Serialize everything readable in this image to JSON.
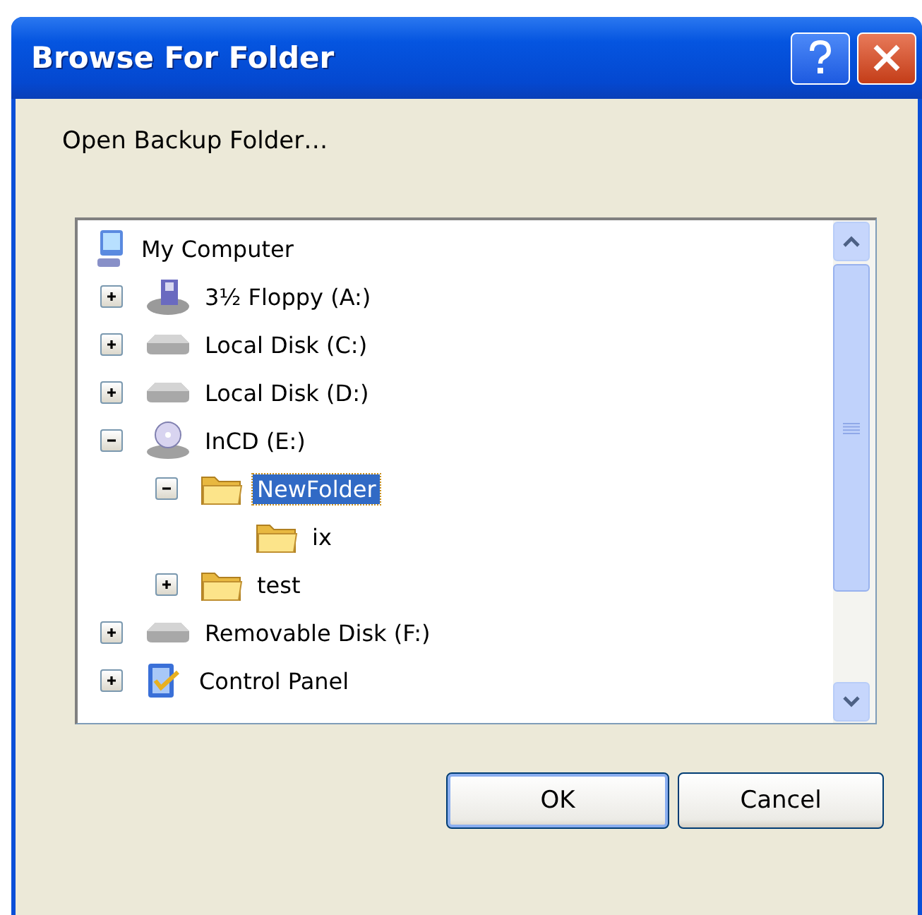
{
  "window": {
    "title": "Browse For Folder"
  },
  "description": "Open Backup Folder…",
  "tree": [
    {
      "label": "My Computer",
      "kind": "computer",
      "selected": false,
      "children": [
        {
          "label": "3½ Floppy (A:)",
          "kind": "floppy",
          "selected": false,
          "expanded": false
        },
        {
          "label": "Local Disk (C:)",
          "kind": "disk",
          "selected": false,
          "expanded": false
        },
        {
          "label": "Local Disk (D:)",
          "kind": "disk",
          "selected": false,
          "expanded": false
        },
        {
          "label": "InCD (E:)",
          "kind": "cd",
          "selected": false,
          "expanded": true,
          "children": [
            {
              "label": "NewFolder",
              "kind": "folder",
              "selected": true,
              "expanded": true,
              "children": [
                {
                  "label": "ix",
                  "kind": "folder",
                  "selected": false
                }
              ]
            },
            {
              "label": "test",
              "kind": "folder",
              "selected": false,
              "expanded": false
            }
          ]
        },
        {
          "label": "Removable Disk (F:)",
          "kind": "disk",
          "selected": false,
          "expanded": false
        },
        {
          "label": "Control Panel",
          "kind": "control",
          "selected": false,
          "expanded": false
        }
      ]
    }
  ],
  "buttons": [
    "OK",
    "Cancel"
  ]
}
